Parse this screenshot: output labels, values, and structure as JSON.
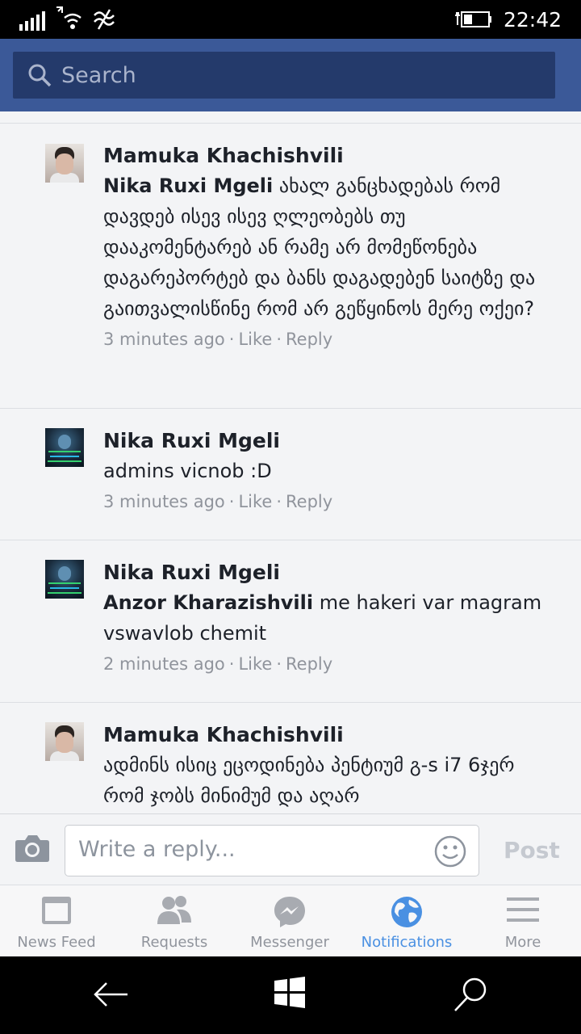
{
  "status_bar": {
    "time": "22:42"
  },
  "search": {
    "placeholder": "Search"
  },
  "comments": [
    {
      "author": "Mamuka Khachishvili",
      "mention": "Nika Ruxi Mgeli",
      "text": " ახალ განცხადებას რომ დავდებ ისევ ისევ ღლეობებს თუ დააკომენტარებ ან რამე არ მომეწონება დაგარეპორტებ და ბანს დაგადებენ საიტზე და გაითვალისწინე რომ არ გეწყინოს მერე ოქეი?",
      "time": "3 minutes ago",
      "like": "Like",
      "reply": "Reply"
    },
    {
      "author": "Nika Ruxi Mgeli",
      "mention": "",
      "text": "admins vicnob :D",
      "time": "3 minutes ago",
      "like": "Like",
      "reply": "Reply"
    },
    {
      "author": "Nika Ruxi Mgeli",
      "mention": "Anzor Kharazishvili",
      "text": " me hakeri var magram vswavlob chemit",
      "time": "2 minutes ago",
      "like": "Like",
      "reply": "Reply"
    },
    {
      "author": "Mamuka Khachishvili",
      "mention": "",
      "text": "ადმინს ისიც ეცოდინება პენტიუმ გ-s i7 6ჯერ რომ ჯობს მინიმუმ და აღარ",
      "time": "",
      "like": "",
      "reply": ""
    }
  ],
  "composer": {
    "placeholder": "Write a reply...",
    "post_label": "Post"
  },
  "bottom_nav": [
    {
      "label": "News Feed",
      "icon": "news-feed-icon"
    },
    {
      "label": "Requests",
      "icon": "friend-requests-icon"
    },
    {
      "label": "Messenger",
      "icon": "messenger-icon"
    },
    {
      "label": "Notifications",
      "icon": "globe-icon",
      "active": true
    },
    {
      "label": "More",
      "icon": "hamburger-menu-icon"
    }
  ],
  "colors": {
    "header": "#3b5998",
    "active_tab": "#4a90e2",
    "meta_text": "#90949c"
  }
}
